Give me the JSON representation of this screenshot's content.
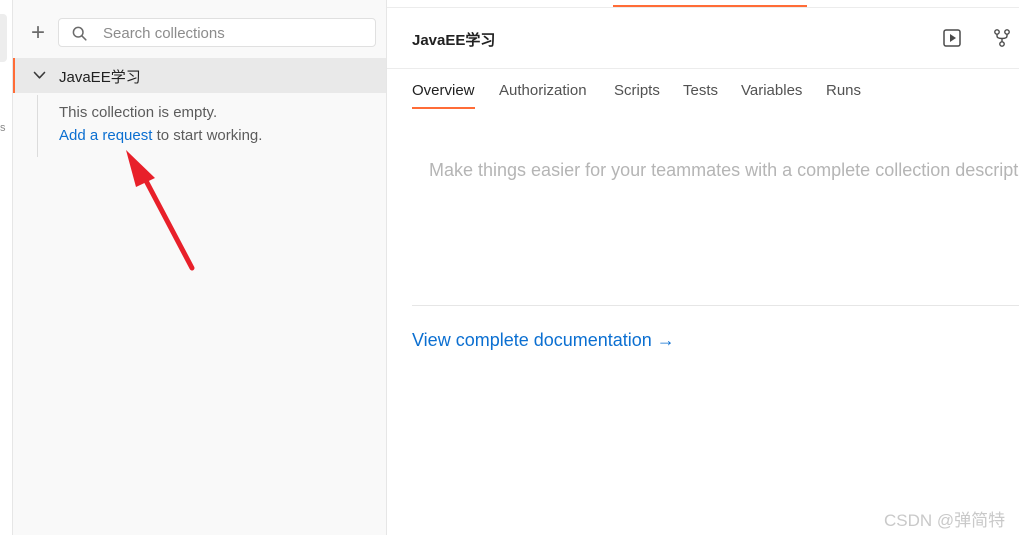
{
  "sidebar": {
    "search_placeholder": "Search collections",
    "collection": {
      "name": "JavaEE学习",
      "empty_text": "This collection is empty.",
      "add_request_link": "Add a request",
      "add_request_suffix": " to start working."
    }
  },
  "main": {
    "title": "JavaEE学习",
    "tabs": [
      {
        "label": "Overview",
        "active": true
      },
      {
        "label": "Authorization",
        "active": false
      },
      {
        "label": "Scripts",
        "active": false
      },
      {
        "label": "Tests",
        "active": false
      },
      {
        "label": "Variables",
        "active": false
      },
      {
        "label": "Runs",
        "active": false
      }
    ],
    "description_placeholder": "Make things easier for your teammates with a complete collection description.",
    "doc_link": "View complete documentation →",
    "actions": [
      "run-icon",
      "fork-icon"
    ]
  },
  "watermark": "CSDN @弹简特",
  "colors": {
    "accent": "#ff6c37",
    "link": "#0b6fd1",
    "annotation_arrow": "#e8202a"
  }
}
